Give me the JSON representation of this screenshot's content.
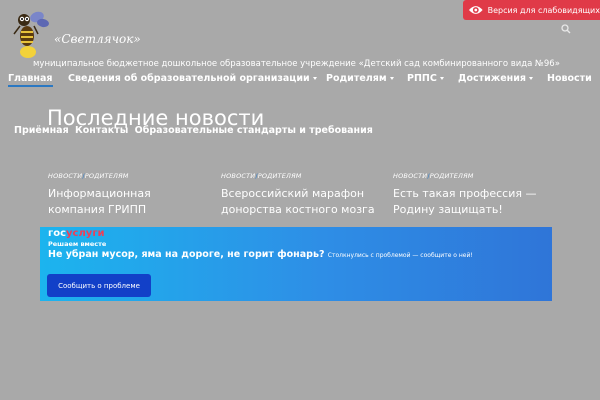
{
  "header": {
    "logo_text": "«Светлячок»",
    "a11y_label": "Версия для слабовидящих",
    "org_name": "муниципальное бюджетное дошкольное образовательное учреждение «Детский сад комбинированного вида №96»"
  },
  "nav": {
    "items": [
      {
        "label": "Главная",
        "dropdown": false
      },
      {
        "label": "Сведения об образовательной организации",
        "dropdown": true
      },
      {
        "label": "Родителям",
        "dropdown": true
      },
      {
        "label": "РППС",
        "dropdown": true
      },
      {
        "label": "Достижения",
        "dropdown": true
      },
      {
        "label": "Новости",
        "dropdown": false
      }
    ],
    "active_index": 0
  },
  "main": {
    "heading": "Последние новости",
    "subnav": [
      "Приёмная",
      "Контакты",
      "Образовательные стандарты и требования"
    ]
  },
  "news": [
    {
      "cat1": "НОВОСТИ",
      "cat2": "РОДИТЕЛЯМ",
      "title": "Информационная компания ГРИПП"
    },
    {
      "cat1": "НОВОСТИ",
      "cat2": "РОДИТЕЛЯМ",
      "title": "Всероссийский марафон донорства костного мозга"
    },
    {
      "cat1": "НОВОСТИ",
      "cat2": "РОДИТЕЛЯМ",
      "title": "Есть такая профессия — Родину защищать!"
    }
  ],
  "banner": {
    "logo_gos": "гос",
    "logo_uslugi": "услуги",
    "subtitle": "Решаем вместе",
    "headline": "Не убран мусор, яма на дороге, не горит фонарь?",
    "note": "Столкнулись с проблемой — сообщите о ней!",
    "button": "Сообщить о проблеме"
  },
  "colors": {
    "background": "#a9a9a9",
    "a11y_red": "#e03a48",
    "accent_blue": "#2b78c2",
    "banner_button": "#1240c8"
  }
}
